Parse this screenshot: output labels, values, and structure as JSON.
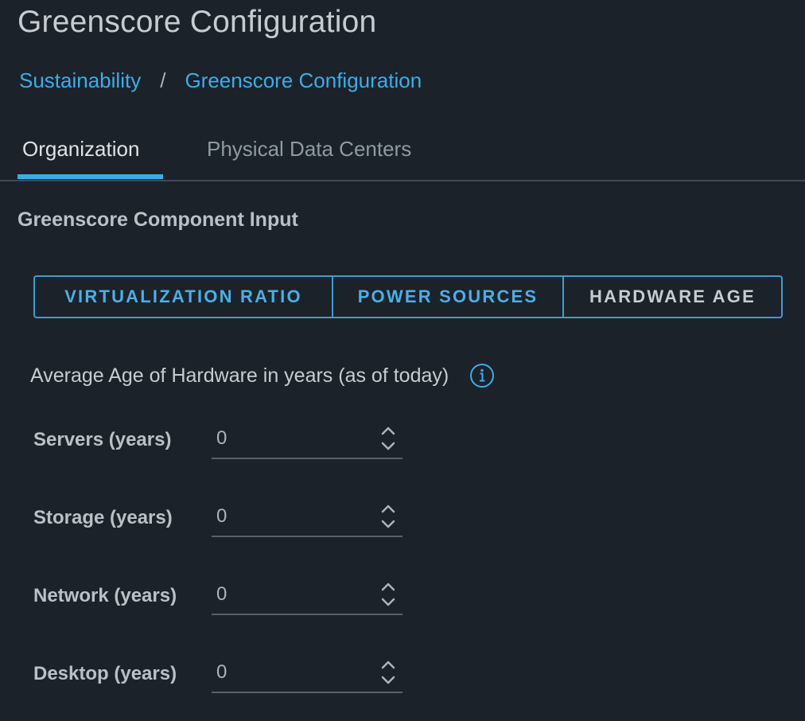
{
  "page": {
    "title": "Greenscore Configuration"
  },
  "breadcrumb": {
    "items": [
      "Sustainability",
      "Greenscore Configuration"
    ],
    "separator": "/"
  },
  "tabs": [
    {
      "label": "Organization",
      "active": true
    },
    {
      "label": "Physical Data Centers",
      "active": false
    }
  ],
  "section": {
    "title": "Greenscore Component Input"
  },
  "segments": [
    {
      "label": "VIRTUALIZATION RATIO",
      "active": false
    },
    {
      "label": "POWER SOURCES",
      "active": false
    },
    {
      "label": "HARDWARE AGE",
      "active": true
    }
  ],
  "hardware_age": {
    "heading": "Average Age of Hardware in years (as of today)",
    "info_icon": "info-circle-icon",
    "fields": [
      {
        "label": "Servers (years)",
        "value": "0"
      },
      {
        "label": "Storage (years)",
        "value": "0"
      },
      {
        "label": "Network (years)",
        "value": "0"
      },
      {
        "label": "Desktop (years)",
        "value": "0"
      }
    ]
  },
  "colors": {
    "background": "#1b2229",
    "accent": "#3aaee8",
    "text_primary": "#c6cdd2",
    "text_muted": "#8f9aa3",
    "divider": "#3d4a54"
  }
}
